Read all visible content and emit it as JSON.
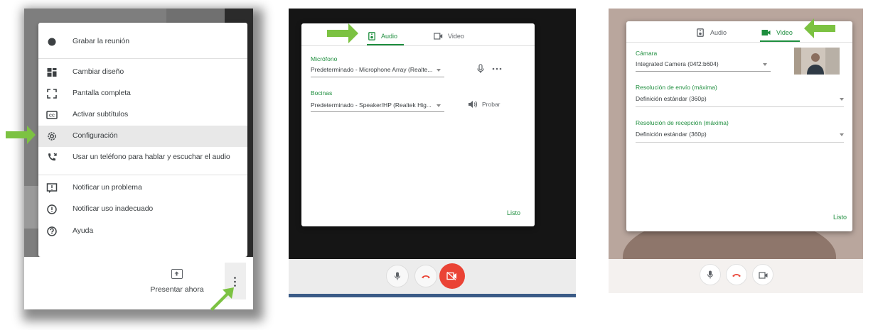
{
  "panel_menu": {
    "items": [
      {
        "label": "Grabar la reunión",
        "icon": "record-icon"
      },
      {
        "label": "Cambiar diseño",
        "icon": "layout-icon"
      },
      {
        "label": "Pantalla completa",
        "icon": "fullscreen-icon"
      },
      {
        "label": "Activar subtítulos",
        "icon": "captions-icon"
      },
      {
        "label": "Configuración",
        "icon": "gear-icon"
      },
      {
        "label": "Usar un teléfono para hablar y escuchar el audio",
        "icon": "phone-icon"
      },
      {
        "label": "Notificar un problema",
        "icon": "report-problem-icon"
      },
      {
        "label": "Notificar uso inadecuado",
        "icon": "report-abuse-icon"
      },
      {
        "label": "Ayuda",
        "icon": "help-icon"
      }
    ],
    "present_label": "Presentar ahora"
  },
  "panel_audio": {
    "tabs": {
      "audio": "Audio",
      "video": "Video"
    },
    "microphone_label": "Micrófono",
    "microphone_value": "Predeterminado - Microphone Array (Realte...",
    "speakers_label": "Bocinas",
    "speakers_value": "Predeterminado - Speaker/HP (Realtek Hig...",
    "test_label": "Probar",
    "done_label": "Listo"
  },
  "panel_video": {
    "tabs": {
      "audio": "Audio",
      "video": "Video"
    },
    "camera_label": "Cámara",
    "camera_value": "Integrated Camera (04f2:b604)",
    "send_res_label": "Resolución de envío (máxima)",
    "send_res_value": "Definición estándar (360p)",
    "recv_res_label": "Resolución de recepción (máxima)",
    "recv_res_value": "Definición estándar (360p)",
    "done_label": "Listo"
  },
  "colors": {
    "accent_green": "#1e8e3e",
    "arrow_green": "#7cc242",
    "end_call_red": "#ea4335"
  }
}
